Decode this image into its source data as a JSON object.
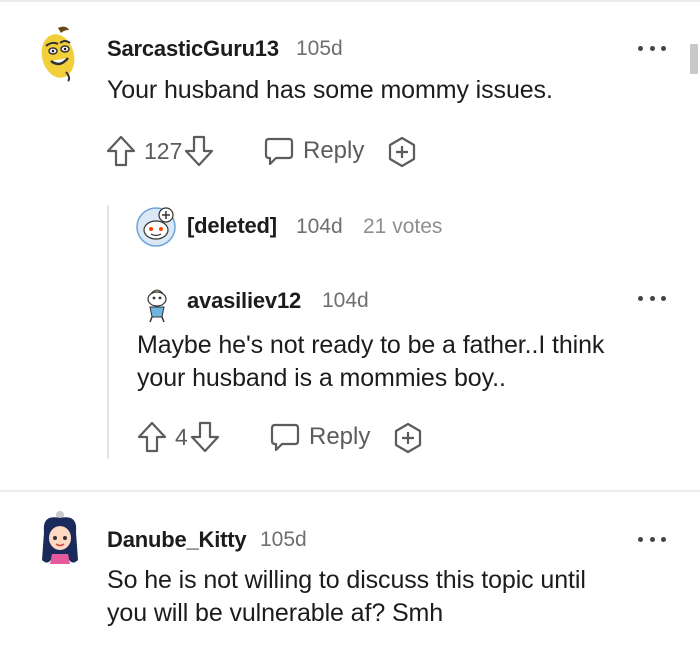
{
  "comments": [
    {
      "username": "SarcasticGuru13",
      "age": "105d",
      "body": "Your husband has some mommy issues.",
      "votes": "127",
      "reply_label": "Reply"
    },
    {
      "username": "[deleted]",
      "age": "104d",
      "votes_meta": "21 votes"
    },
    {
      "username": "avasiliev12",
      "age": "104d",
      "body_lines": [
        "Maybe he's not ready to be a father..I think",
        "your husband is a mommies boy.."
      ],
      "votes": "4",
      "reply_label": "Reply"
    },
    {
      "username": "Danube_Kitty",
      "age": "105d",
      "body_lines": [
        "So he is not willing to discuss this topic until",
        "you will be vulnerable af? Smh"
      ]
    }
  ],
  "icons": {
    "upvote": "upvote-arrow-icon",
    "downvote": "downvote-arrow-icon",
    "reply": "speech-bubble-icon",
    "award": "award-plus-icon",
    "more": "more-dots-icon"
  },
  "colors": {
    "text": "#1c1c1c",
    "meta": "#6d6f72",
    "action": "#5a5c5f"
  }
}
